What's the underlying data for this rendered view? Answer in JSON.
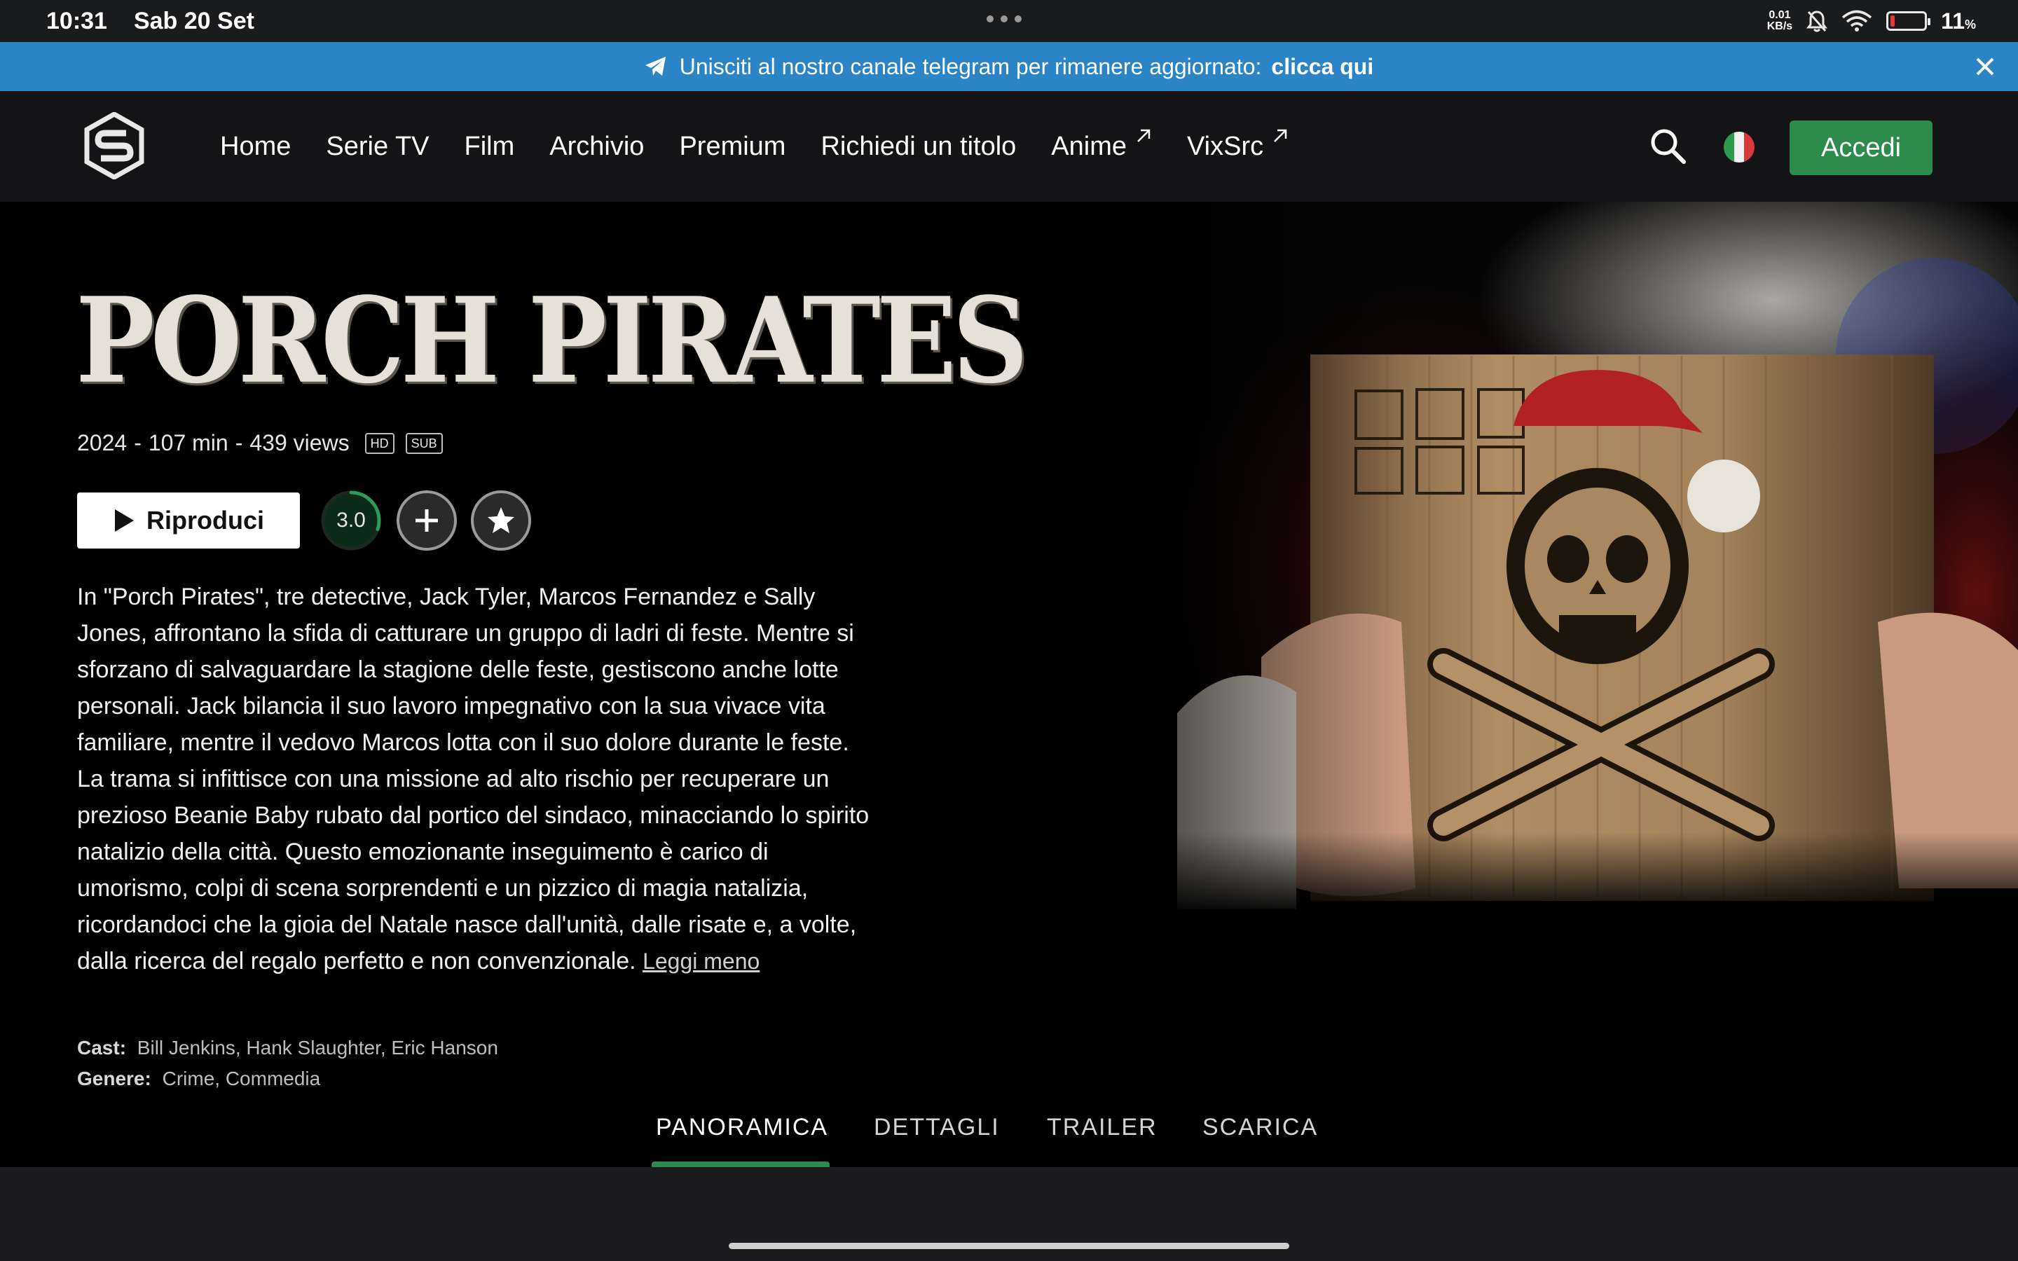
{
  "status_bar": {
    "time": "10:31",
    "date": "Sab 20 Set",
    "net_speed_value": "0.01",
    "net_speed_unit": "KB/s",
    "battery_percent": "11",
    "battery_percent_sign": "%",
    "battery_level": 0.11
  },
  "banner": {
    "text": "Unisciti al nostro canale telegram per rimanere aggiornato:",
    "link": "clicca qui",
    "color": "#2b84c6"
  },
  "nav": {
    "items": [
      {
        "label": "Home"
      },
      {
        "label": "Serie TV"
      },
      {
        "label": "Film"
      },
      {
        "label": "Archivio"
      },
      {
        "label": "Premium"
      },
      {
        "label": "Richiedi un titolo"
      },
      {
        "label": "Anime"
      },
      {
        "label": "VixSrc"
      }
    ],
    "login_label": "Accedi",
    "accent_color": "#2e8b4e"
  },
  "movie": {
    "title": "PORCH PIRATES",
    "year": "2024",
    "duration": "107 min",
    "views": "439 views",
    "sep": "-",
    "badges": [
      "HD",
      "SUB"
    ],
    "play_label": "Riproduci",
    "rating": "3.0",
    "rating_fraction": 0.3,
    "plot": "In \"Porch Pirates\", tre detective, Jack Tyler, Marcos Fernandez e Sally Jones, affrontano la sfida di catturare un gruppo di ladri di feste. Mentre si sforzano di salvaguardare la stagione delle feste, gestiscono anche lotte personali. Jack bilancia il suo lavoro impegnativo con la sua vivace vita familiare, mentre il vedovo Marcos lotta con il suo dolore durante le feste. La trama si infittisce con una missione ad alto rischio per recuperare un prezioso Beanie Baby rubato dal portico del sindaco, minacciando lo spirito natalizio della città. Questo emozionante inseguimento è carico di umorismo, colpi di scena sorprendenti e un pizzico di magia natalizia, ricordandoci che la gioia del Natale nasce dall'unità, dalle risate e, a volte, dalla ricerca del regalo perfetto e non convenzionale.",
    "read_less": "Leggi meno",
    "cast_label": "Cast:",
    "cast": "Bill Jenkins, Hank Slaughter, Eric Hanson",
    "genre_label": "Genere:",
    "genre": "Crime, Commedia"
  },
  "tabs": [
    {
      "label": "PANORAMICA",
      "active": true
    },
    {
      "label": "DETTAGLI",
      "active": false
    },
    {
      "label": "TRAILER",
      "active": false
    },
    {
      "label": "SCARICA",
      "active": false
    }
  ],
  "icons": {
    "banner": "telegram-icon",
    "close": "close-icon",
    "logo": "streamingcommunity-logo",
    "search": "search-icon",
    "flag": "italy-flag-icon",
    "external": "external-link-icon",
    "play": "play-icon",
    "add": "plus-icon",
    "favorite": "star-icon"
  }
}
